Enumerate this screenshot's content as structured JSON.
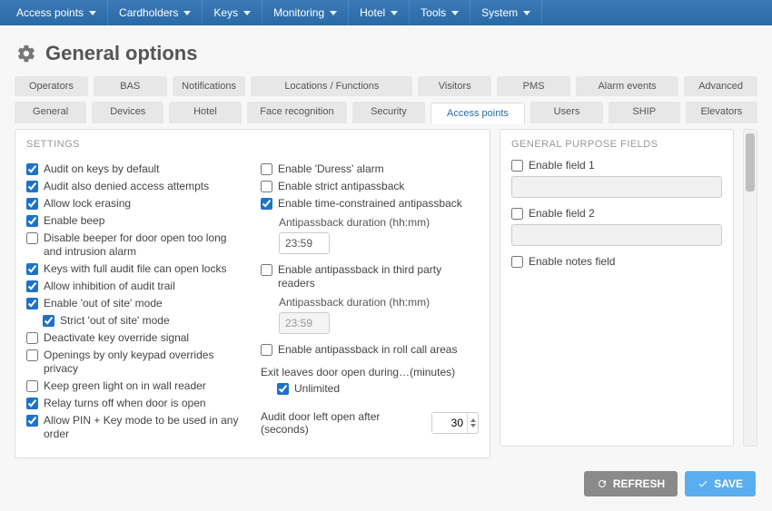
{
  "nav": {
    "items": [
      "Access points",
      "Cardholders",
      "Keys",
      "Monitoring",
      "Hotel",
      "Tools",
      "System"
    ]
  },
  "title": "General options",
  "tabs_row1": [
    "Operators",
    "BAS",
    "Notifications",
    "Locations / Functions",
    "Visitors",
    "PMS",
    "Alarm events",
    "Advanced"
  ],
  "tabs_row2": [
    "General",
    "Devices",
    "Hotel",
    "Face recognition",
    "Security",
    "Access points",
    "Users",
    "SHIP",
    "Elevators"
  ],
  "active_tab_row2_index": 5,
  "settings": {
    "header": "SETTINGS",
    "col1": [
      {
        "label": "Audit on keys by default",
        "checked": true
      },
      {
        "label": "Audit also denied access attempts",
        "checked": true
      },
      {
        "label": "Allow lock erasing",
        "checked": true
      },
      {
        "label": "Enable beep",
        "checked": true
      },
      {
        "label": "Disable beeper for door open too long and intrusion alarm",
        "checked": false
      },
      {
        "label": "Keys with full audit file can open locks",
        "checked": true
      },
      {
        "label": "Allow inhibition of audit trail",
        "checked": true
      },
      {
        "label": "Enable 'out of site' mode",
        "checked": true
      },
      {
        "label": "Strict 'out of site' mode",
        "checked": true,
        "indent": true
      },
      {
        "label": "Deactivate key override signal",
        "checked": false
      },
      {
        "label": "Openings by only keypad overrides privacy",
        "checked": false
      },
      {
        "label": "Keep green light on in wall reader",
        "checked": false
      },
      {
        "label": "Relay turns off when door is open",
        "checked": true
      },
      {
        "label": "Allow PIN + Key mode to be used in any order",
        "checked": true
      }
    ],
    "col2": {
      "enable_duress_label": "Enable 'Duress' alarm",
      "enable_duress_checked": false,
      "enable_strict_apb_label": "Enable strict antipassback",
      "enable_strict_apb_checked": false,
      "enable_time_apb_label": "Enable time-constrained antipassback",
      "enable_time_apb_checked": true,
      "apb_duration1_label": "Antipassback duration (hh:mm)",
      "apb_duration1_value": "23:59",
      "enable_apb_3p_label": "Enable antipassback in third party readers",
      "enable_apb_3p_checked": false,
      "apb_duration2_label": "Antipassback duration (hh:mm)",
      "apb_duration2_value": "23:59",
      "enable_apb_rollcall_label": "Enable antipassback in roll call areas",
      "enable_apb_rollcall_checked": false,
      "exit_leaves_label": "Exit leaves door open during…(minutes)",
      "unlimited_label": "Unlimited",
      "unlimited_checked": true,
      "audit_door_label": "Audit door left open after (seconds)",
      "audit_door_value": "30"
    }
  },
  "gpf": {
    "header": "GENERAL PURPOSE FIELDS",
    "field1_label": "Enable field 1",
    "field1_checked": false,
    "field2_label": "Enable field 2",
    "field2_checked": false,
    "notes_label": "Enable notes field",
    "notes_checked": false
  },
  "footer": {
    "refresh": "REFRESH",
    "save": "SAVE"
  }
}
